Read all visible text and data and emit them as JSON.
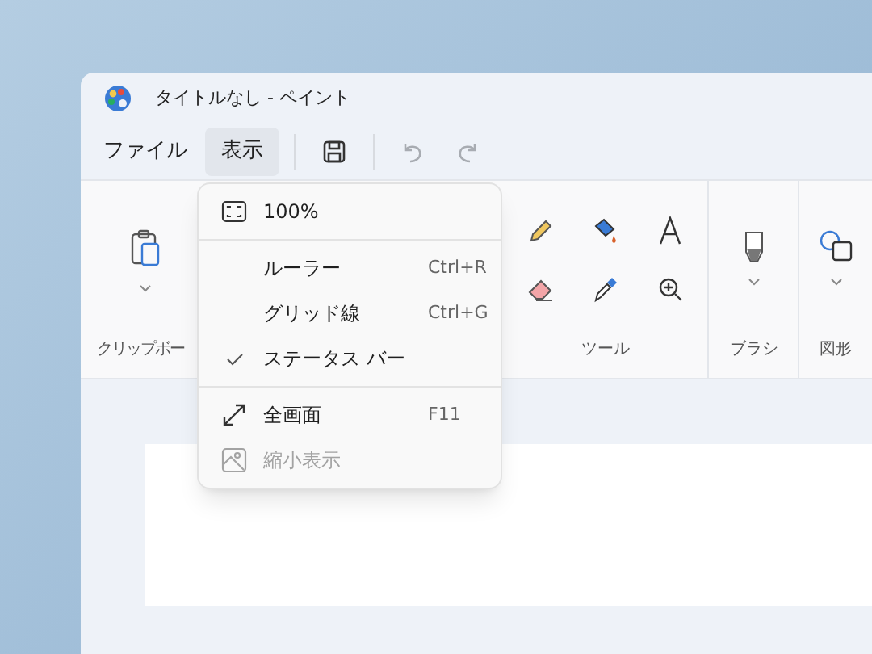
{
  "window": {
    "title": "タイトルなし - ペイント"
  },
  "menu_bar": [
    {
      "label": "ファイル",
      "selected": false
    },
    {
      "label": "表示",
      "selected": true
    }
  ],
  "toolbar": [
    {
      "kind": "save",
      "disabled": false
    },
    {
      "kind": "undo",
      "disabled": true
    },
    {
      "kind": "redo",
      "disabled": true
    }
  ],
  "ribbon": {
    "groups": [
      {
        "kind": "clipboard",
        "label": "クリップボー"
      },
      {
        "kind": "tools",
        "label": "ツール"
      },
      {
        "kind": "brush",
        "label": "ブラシ"
      },
      {
        "kind": "shapes",
        "label": "図形"
      }
    ]
  },
  "view_menu": {
    "sections": [
      [
        {
          "kind": "zoom",
          "label": "100%",
          "disabled": false
        }
      ],
      [
        {
          "kind": "toggle",
          "label": "ルーラー",
          "shortcut": "Ctrl+R",
          "checked": false,
          "disabled": false
        },
        {
          "kind": "toggle",
          "label": "グリッド線",
          "shortcut": "Ctrl+G",
          "checked": false,
          "disabled": false
        },
        {
          "kind": "toggle",
          "label": "ステータス バー",
          "checked": true,
          "disabled": false
        }
      ],
      [
        {
          "kind": "fullscreen",
          "label": "全画面",
          "shortcut": "F11",
          "disabled": false
        },
        {
          "kind": "thumbnail",
          "label": "縮小表示",
          "disabled": true
        }
      ]
    ]
  }
}
